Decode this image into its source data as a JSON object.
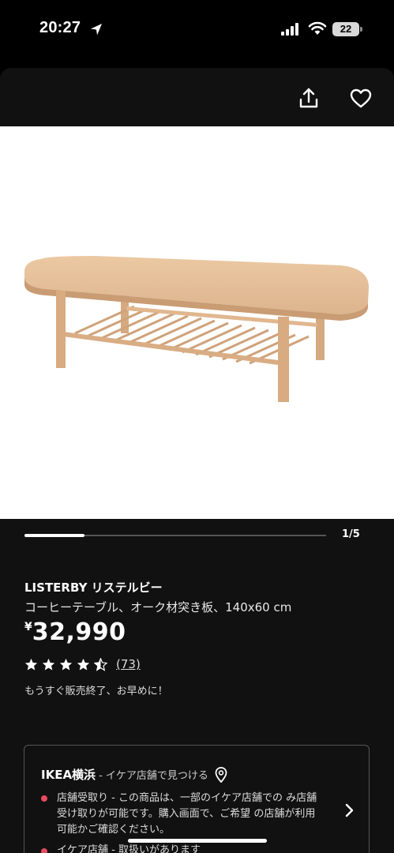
{
  "status": {
    "time": "20:27",
    "battery": "22",
    "icons": [
      "location-arrow-icon",
      "signal-icon",
      "wifi-icon",
      "battery-icon"
    ]
  },
  "header": {
    "actions": [
      "share-icon",
      "heart-icon"
    ]
  },
  "gallery": {
    "counter": "1/5",
    "progress": 0.2
  },
  "product": {
    "name": "LISTERBY リステルビー",
    "description": "コーヒーテーブル、オーク材突き板、140x60 cm",
    "currency": "¥",
    "price": "32,990",
    "rating": 4.5,
    "review_count": "(73)",
    "notice": "もうすぐ販売終了、お早めに！"
  },
  "store": {
    "name": "IKEA横浜",
    "subtitle": "- イケア店舗で見つける",
    "line1": "店舗受取り - この商品は、一部のイケア店舗での み店舗受け取りが可能です。購入画面で、ご希望 の店舗が利用可能かご確認ください。",
    "line2": "イケア店舗 - 取扱いがあります"
  },
  "colors": {
    "background": "#111111",
    "accent_dot": "#e84a5f",
    "wood": "#dcb48d"
  }
}
